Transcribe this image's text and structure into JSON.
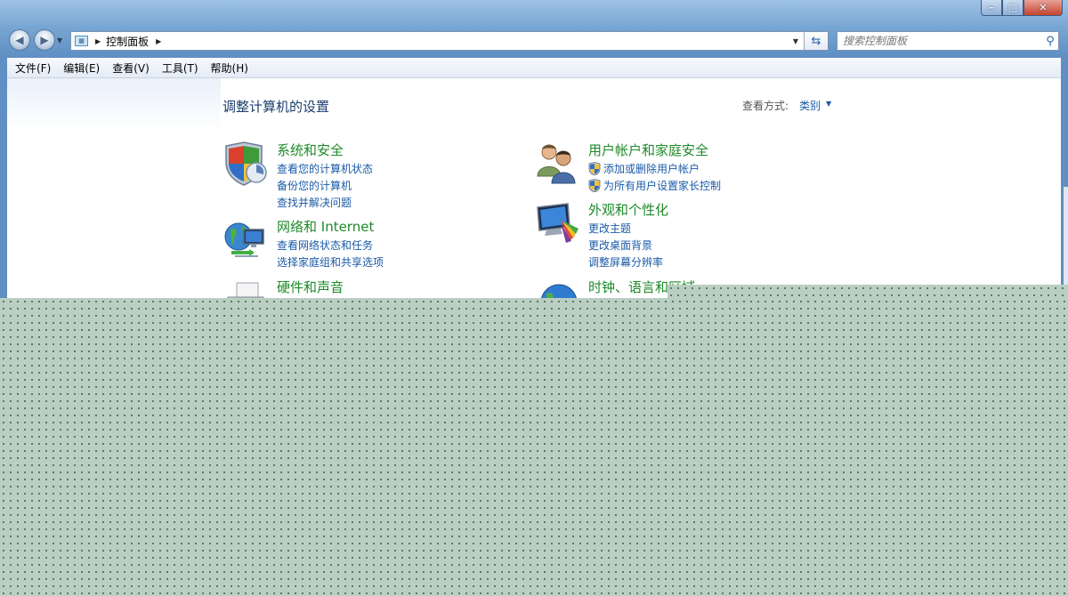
{
  "window": {
    "controls": {
      "minimize_icon": "minimize-icon",
      "maximize_icon": "maximize-icon",
      "close_icon": "close-icon"
    }
  },
  "navigation": {
    "back_icon": "back-arrow-icon",
    "forward_icon": "forward-arrow-icon",
    "address": {
      "breadcrumb": "控制面板"
    },
    "search": {
      "placeholder": "搜索控制面板"
    }
  },
  "menubar": {
    "items": [
      "文件(F)",
      "编辑(E)",
      "查看(V)",
      "工具(T)",
      "帮助(H)"
    ]
  },
  "main": {
    "title": "调整计算机的设置",
    "view_by_label": "查看方式:",
    "view_mode": "类别",
    "categories": [
      {
        "title": "系统和安全",
        "icon": "shield-icon",
        "links": [
          "查看您的计算机状态",
          "备份您的计算机",
          "查找并解决问题"
        ]
      },
      {
        "title": "网络和 Internet",
        "icon": "network-globe-icon",
        "links": [
          "查看网络状态和任务",
          "选择家庭组和共享选项"
        ]
      },
      {
        "title": "硬件和声音",
        "icon": "printer-icon",
        "links": []
      },
      {
        "title": "用户帐户和家庭安全",
        "icon": "users-icon",
        "links": [
          "添加或删除用户帐户",
          "为所有用户设置家长控制"
        ]
      },
      {
        "title": "外观和个性化",
        "icon": "monitor-palette-icon",
        "links": [
          "更改主题",
          "更改桌面背景",
          "调整屏幕分辨率"
        ]
      },
      {
        "title": "时钟、语言和区域",
        "icon": "clock-globe-icon",
        "links": []
      }
    ]
  },
  "colors": {
    "link": "#1a5aa8",
    "category_title": "#1e8a2a",
    "frame": "#5f8fc4",
    "pattern_bg": "#b9cfc1"
  }
}
